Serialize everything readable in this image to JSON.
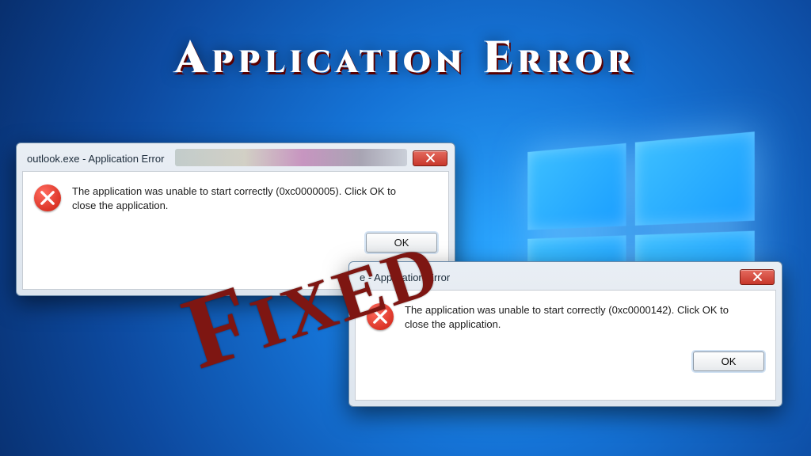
{
  "headline": "Application Error",
  "stamp": "Fixed",
  "dialog1": {
    "title": "outlook.exe - Application Error",
    "message": "The application was unable to start correctly (0xc0000005). Click OK to close the application.",
    "ok_label": "OK"
  },
  "dialog2": {
    "title": "e - Application Error",
    "message": "The application was unable to start correctly (0xc0000142). Click OK to close the application.",
    "ok_label": "OK"
  }
}
